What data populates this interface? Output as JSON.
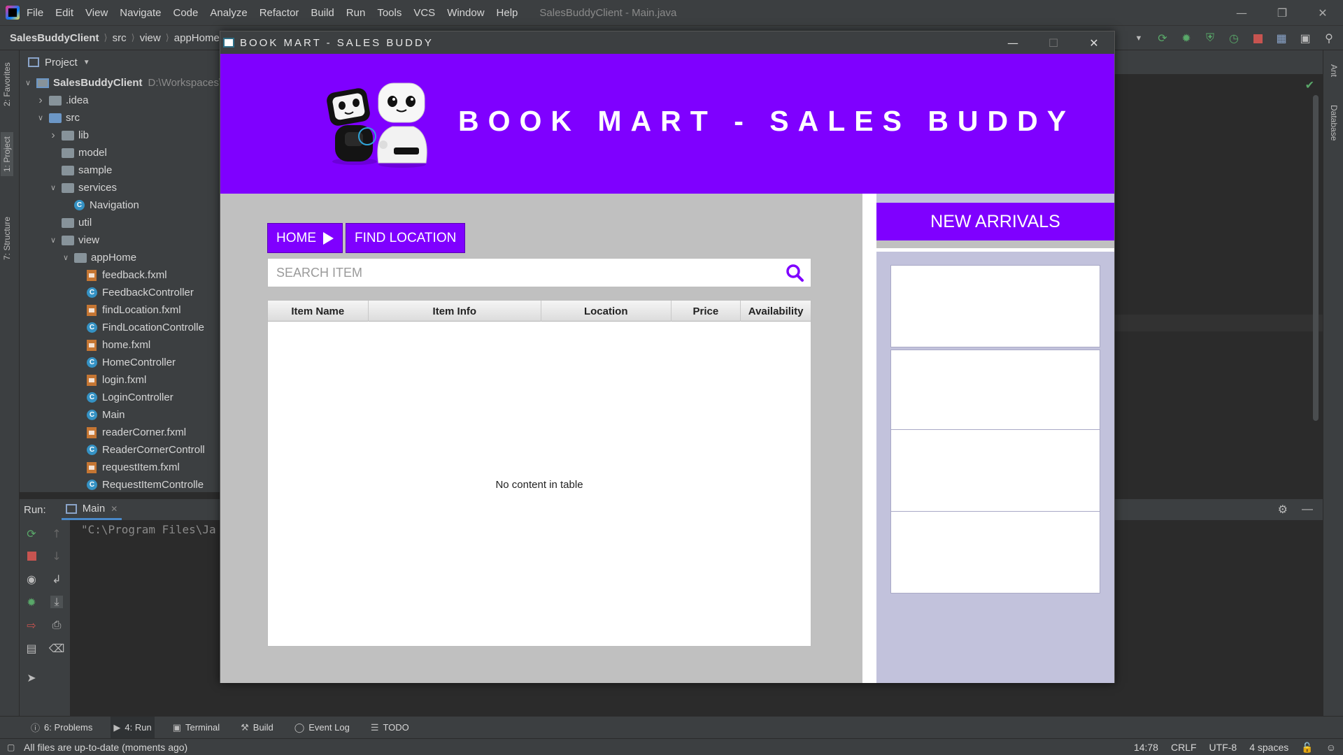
{
  "ide": {
    "menu": [
      "File",
      "Edit",
      "View",
      "Navigate",
      "Code",
      "Analyze",
      "Refactor",
      "Build",
      "Run",
      "Tools",
      "VCS",
      "Window",
      "Help"
    ],
    "title": "SalesBuddyClient - Main.java",
    "breadcrumbs": [
      "SalesBuddyClient",
      "src",
      "view",
      "appHome"
    ],
    "left_tabs": [
      "2: Favorites",
      "1: Project",
      "7: Structure"
    ],
    "right_tabs": [
      "Ant",
      "Database"
    ],
    "project_panel": {
      "title": "Project",
      "project_path": "D:\\Workspaces\\",
      "tree": [
        {
          "label": "SalesBuddyClient",
          "type": "module",
          "level": 0,
          "expanded": true
        },
        {
          "label": ".idea",
          "type": "folder",
          "level": 1,
          "expanded": false
        },
        {
          "label": "src",
          "type": "folder-blue",
          "level": 1,
          "expanded": true
        },
        {
          "label": "lib",
          "type": "folder",
          "level": 2,
          "expanded": false
        },
        {
          "label": "model",
          "type": "folder",
          "level": 2,
          "expanded": null
        },
        {
          "label": "sample",
          "type": "folder",
          "level": 2,
          "expanded": null
        },
        {
          "label": "services",
          "type": "folder",
          "level": 2,
          "expanded": true
        },
        {
          "label": "Navigation",
          "type": "class",
          "level": 3,
          "expanded": null
        },
        {
          "label": "util",
          "type": "folder",
          "level": 2,
          "expanded": null
        },
        {
          "label": "view",
          "type": "folder",
          "level": 2,
          "expanded": true
        },
        {
          "label": "appHome",
          "type": "folder",
          "level": 3,
          "expanded": true
        },
        {
          "label": "feedback.fxml",
          "type": "fxml",
          "level": 4,
          "expanded": null
        },
        {
          "label": "FeedbackController",
          "type": "class",
          "level": 4,
          "expanded": null
        },
        {
          "label": "findLocation.fxml",
          "type": "fxml",
          "level": 4,
          "expanded": null
        },
        {
          "label": "FindLocationControlle",
          "type": "class",
          "level": 4,
          "expanded": null
        },
        {
          "label": "home.fxml",
          "type": "fxml",
          "level": 4,
          "expanded": null
        },
        {
          "label": "HomeController",
          "type": "class",
          "level": 4,
          "expanded": null
        },
        {
          "label": "login.fxml",
          "type": "fxml",
          "level": 4,
          "expanded": null
        },
        {
          "label": "LoginController",
          "type": "class",
          "level": 4,
          "expanded": null
        },
        {
          "label": "Main",
          "type": "class",
          "level": 4,
          "expanded": null
        },
        {
          "label": "readerCorner.fxml",
          "type": "fxml",
          "level": 4,
          "expanded": null
        },
        {
          "label": "ReaderCornerControll",
          "type": "class",
          "level": 4,
          "expanded": null
        },
        {
          "label": "requestItem.fxml",
          "type": "fxml",
          "level": 4,
          "expanded": null
        },
        {
          "label": "RequestItemControlle",
          "type": "class",
          "level": 4,
          "expanded": null
        }
      ]
    },
    "run_panel": {
      "label": "Run:",
      "tab": "Main",
      "console_line": "\"C:\\Program Files\\Ja"
    },
    "bottom_tools": [
      {
        "label": "6: Problems",
        "icon": "problems-icon",
        "active": false
      },
      {
        "label": "4: Run",
        "icon": "run-icon",
        "active": true
      },
      {
        "label": "Terminal",
        "icon": "terminal-icon",
        "active": false
      },
      {
        "label": "Build",
        "icon": "build-icon",
        "active": false
      },
      {
        "label": "Event Log",
        "icon": "event-log-icon",
        "active": false
      },
      {
        "label": "TODO",
        "icon": "todo-icon",
        "active": false
      }
    ],
    "status": {
      "message": "All files are up-to-date (moments ago)",
      "position": "14:78",
      "line_sep": "CRLF",
      "encoding": "UTF-8",
      "indent": "4 spaces"
    }
  },
  "app": {
    "window_title": "BOOK MART - SALES BUDDY",
    "banner_title": "BOOK MART - SALES BUDDY",
    "home_button": "HOME",
    "find_location_button": "FIND LOCATION",
    "search_placeholder": "SEARCH ITEM",
    "table": {
      "columns": [
        "Item Name",
        "Item Info",
        "Location",
        "Price",
        "Availability"
      ],
      "rows": [],
      "empty_text": "No content in table"
    },
    "new_arrivals_title": "NEW ARRIVALS",
    "arrival_cards": 4,
    "accent_color": "#7f00ff",
    "side_panel_color": "#c2c2dc"
  }
}
